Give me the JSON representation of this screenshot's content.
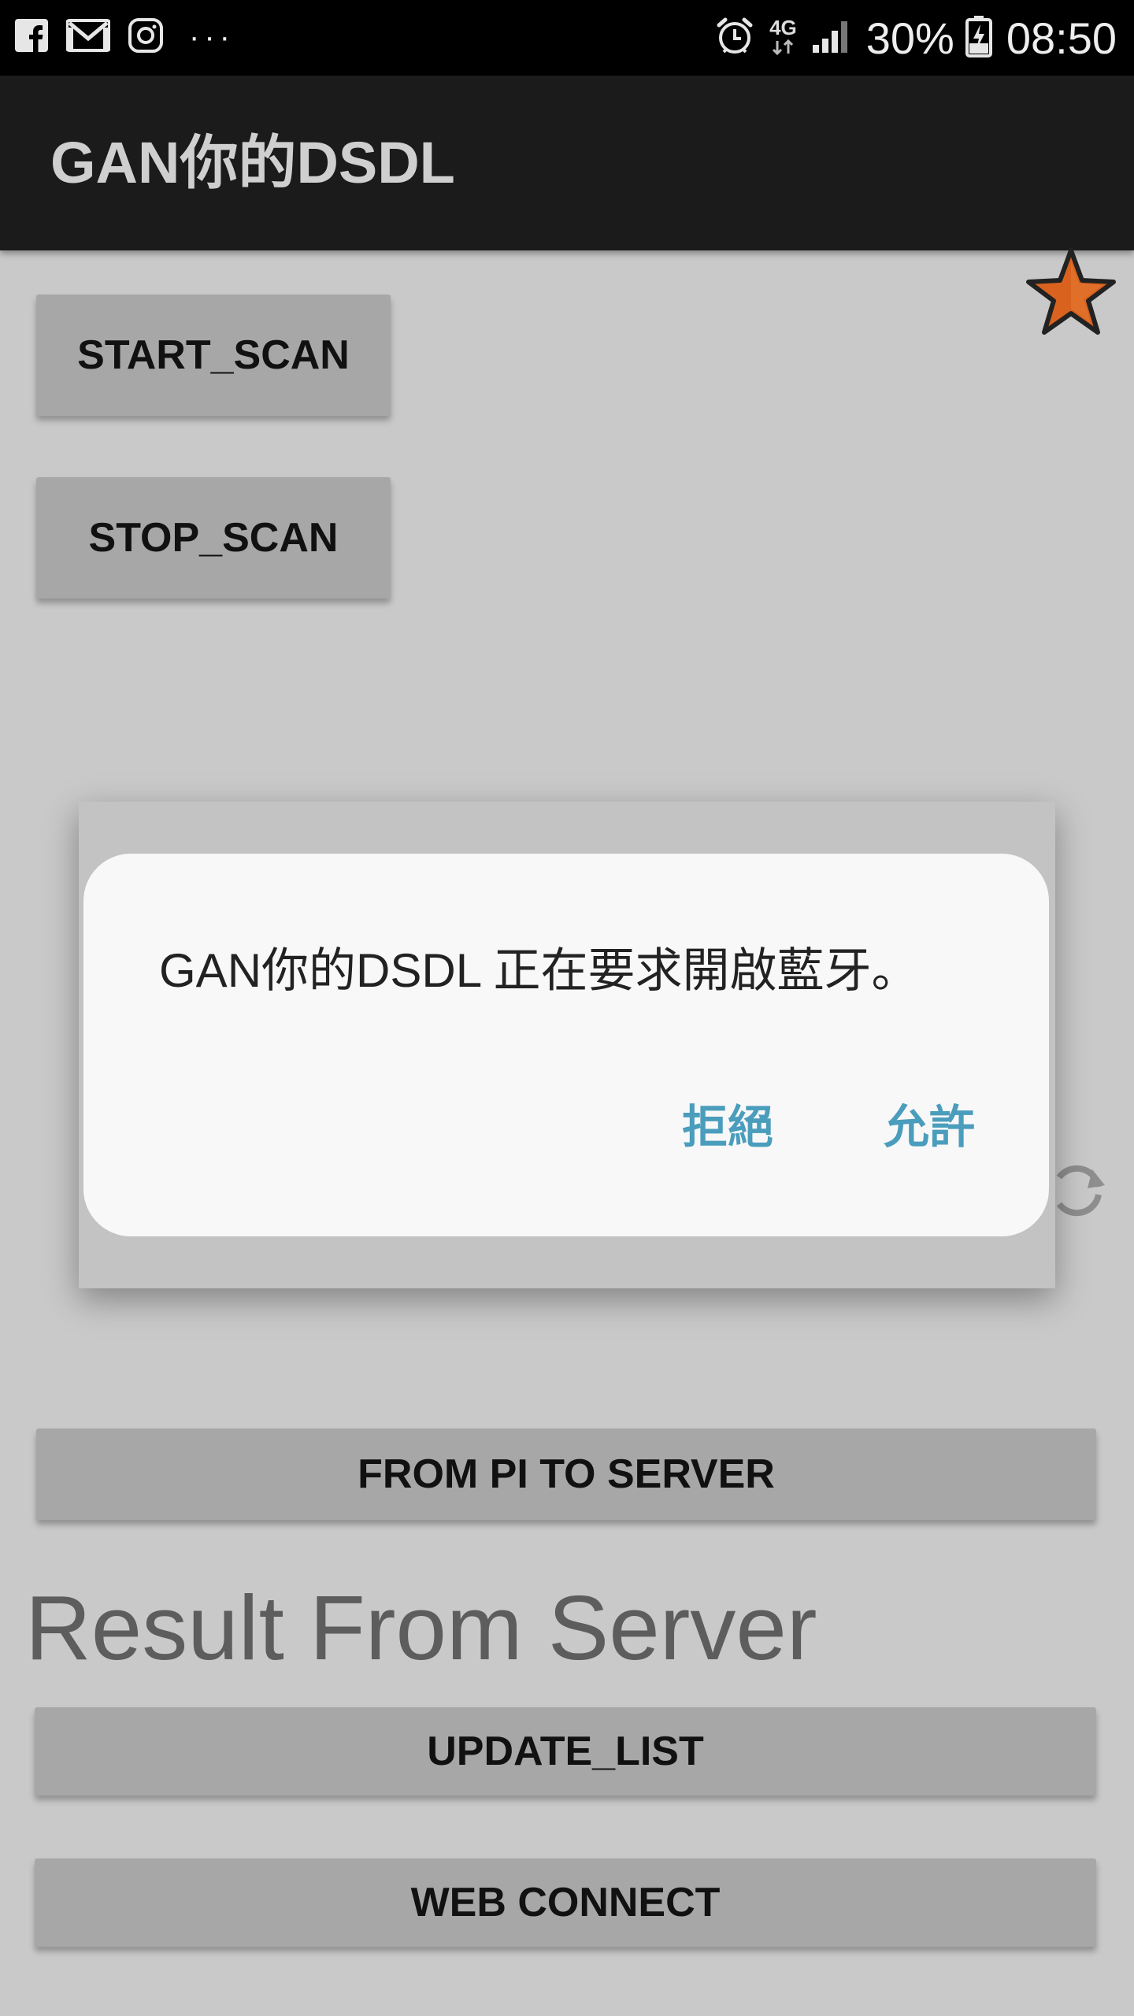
{
  "status_bar": {
    "left_icons": [
      "facebook-icon",
      "gmail-icon",
      "instagram-icon"
    ],
    "more": "···",
    "network": "4G",
    "battery": "30%",
    "time": "08:50"
  },
  "action_bar": {
    "title": "GAN你的DSDL"
  },
  "buttons": {
    "start_scan": "START_SCAN",
    "stop_scan": "STOP_SCAN",
    "from_pi": "FROM PI TO SERVER",
    "update_list": "UPDATE_LIST",
    "web_connect": "WEB CONNECT"
  },
  "result_title": "Result From Server",
  "dialog": {
    "message": "GAN你的DSDL 正在要求開啟藍牙。",
    "deny": "拒絕",
    "allow": "允許"
  },
  "colors": {
    "accent": "#4a9dbc",
    "star": "#d9621f",
    "button": "#a6a7a6"
  }
}
